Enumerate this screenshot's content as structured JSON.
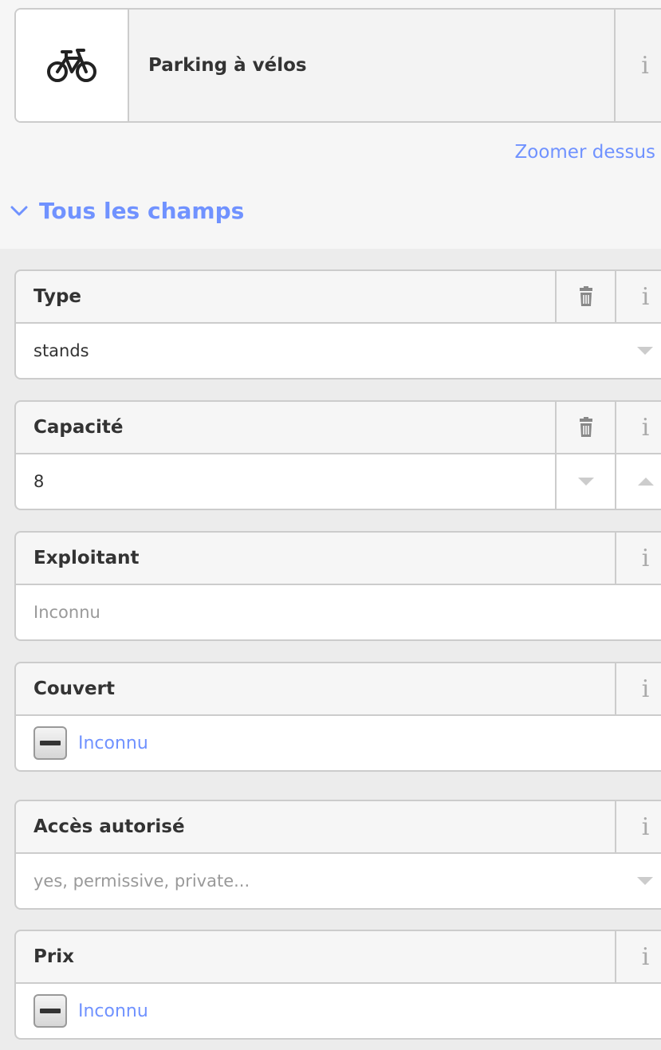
{
  "preset": {
    "icon": "bicycle-icon",
    "name": "Parking à vélos",
    "info": "i"
  },
  "zoom_link": "Zoomer dessus",
  "all_fields": {
    "label": "Tous les champs",
    "expanded": true
  },
  "fields": {
    "type": {
      "label": "Type",
      "value": "stands",
      "info": "i"
    },
    "capacity": {
      "label": "Capacité",
      "value": "8",
      "info": "i"
    },
    "operator": {
      "label": "Exploitant",
      "placeholder": "Inconnu",
      "info": "i"
    },
    "covered": {
      "label": "Couvert",
      "check_label": "Inconnu",
      "info": "i"
    },
    "access": {
      "label": "Accès autorisé",
      "placeholder": "yes, permissive, private...",
      "info": "i"
    },
    "fee": {
      "label": "Prix",
      "check_label": "Inconnu",
      "info": "i"
    }
  },
  "colors": {
    "accent": "#7092ff",
    "border": "#cccccc",
    "panel_bg": "#ececec"
  }
}
